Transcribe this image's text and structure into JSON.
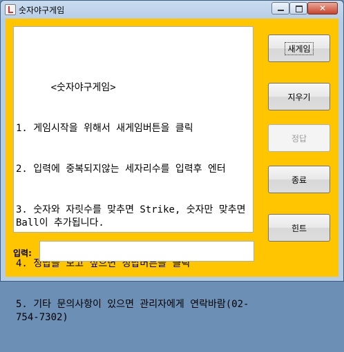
{
  "window": {
    "title": "숫자야구게임",
    "icon": "java-cup-icon"
  },
  "textarea": {
    "lines": [
      "      <숫자야구게임>",
      "1. 게임시작을 위해서 새게임버튼을 클릭",
      "2. 입력에 중복되지않는 세자리수를 입력후 엔터",
      "3. 숫자와 자릿수를 맞추면 Strike, 숫자만 맞추면 Ball이 추가됩니다.",
      "4. 정답을 보고 싶으면 정답버튼을 클릭",
      "5. 기타 문의사항이 있으면 관리자에게 연락바람(02-754-7302)"
    ]
  },
  "input": {
    "label": "입력:",
    "value": ""
  },
  "buttons": {
    "new_game": "새게임",
    "clear": "지우기",
    "answer": "정답",
    "exit": "종료",
    "hint": "힌트"
  },
  "colors": {
    "panel_background": "#ffc600",
    "text_background": "#ffffff"
  }
}
